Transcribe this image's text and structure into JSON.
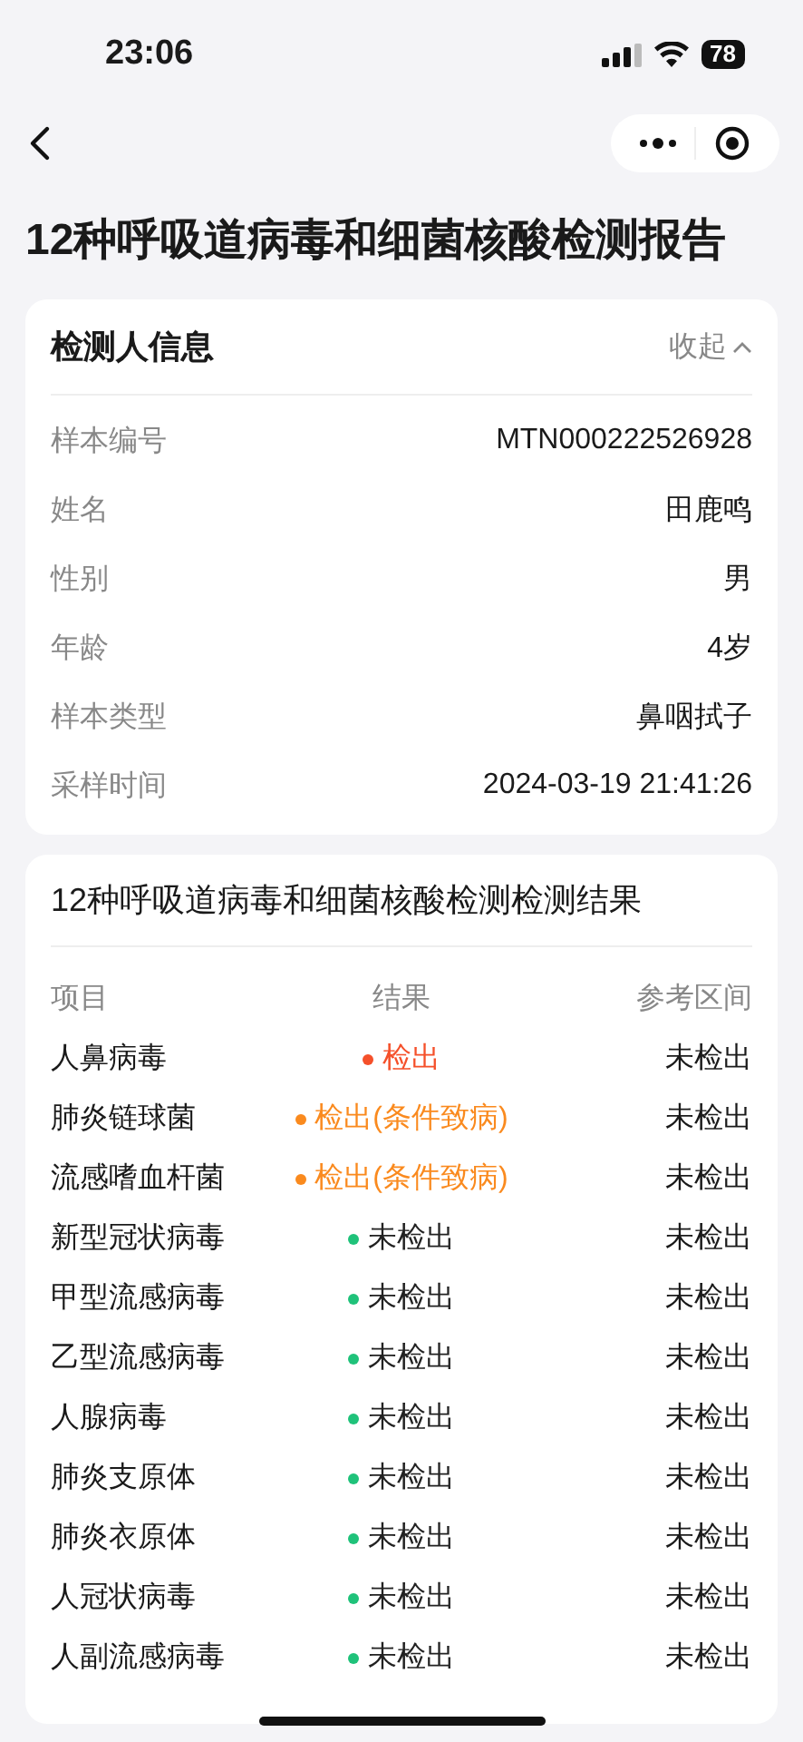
{
  "status_bar": {
    "time": "23:06",
    "battery": "78"
  },
  "page_title": "12种呼吸道病毒和细菌核酸检测报告",
  "info_card": {
    "title": "检测人信息",
    "toggle": "收起",
    "expanded": true,
    "rows": [
      {
        "label": "样本编号",
        "value": "MTN000222526928"
      },
      {
        "label": "姓名",
        "value": "田鹿鸣"
      },
      {
        "label": "性别",
        "value": "男"
      },
      {
        "label": "年龄",
        "value": "4岁"
      },
      {
        "label": "样本类型",
        "value": "鼻咽拭子"
      },
      {
        "label": "采样时间",
        "value": "2024-03-19 21:41:26"
      }
    ]
  },
  "results_card": {
    "title": "12种呼吸道病毒和细菌核酸检测检测结果",
    "columns": [
      "项目",
      "结果",
      "参考区间"
    ],
    "rows": [
      {
        "item": "人鼻病毒",
        "result": "检出",
        "color": "#f5502a",
        "reference": "未检出"
      },
      {
        "item": "肺炎链球菌",
        "result": "检出(条件致病)",
        "color": "#fa8a1e",
        "reference": "未检出"
      },
      {
        "item": "流感嗜血杆菌",
        "result": "检出(条件致病)",
        "color": "#fa8a1e",
        "reference": "未检出"
      },
      {
        "item": "新型冠状病毒",
        "result": "未检出",
        "color": "#1fc27a",
        "reference": "未检出"
      },
      {
        "item": "甲型流感病毒",
        "result": "未检出",
        "color": "#1fc27a",
        "reference": "未检出"
      },
      {
        "item": "乙型流感病毒",
        "result": "未检出",
        "color": "#1fc27a",
        "reference": "未检出"
      },
      {
        "item": "人腺病毒",
        "result": "未检出",
        "color": "#1fc27a",
        "reference": "未检出"
      },
      {
        "item": "肺炎支原体",
        "result": "未检出",
        "color": "#1fc27a",
        "reference": "未检出"
      },
      {
        "item": "肺炎衣原体",
        "result": "未检出",
        "color": "#1fc27a",
        "reference": "未检出"
      },
      {
        "item": "人冠状病毒",
        "result": "未检出",
        "color": "#1fc27a",
        "reference": "未检出"
      },
      {
        "item": "人副流感病毒",
        "result": "未检出",
        "color": "#1fc27a",
        "reference": "未检出"
      }
    ]
  }
}
